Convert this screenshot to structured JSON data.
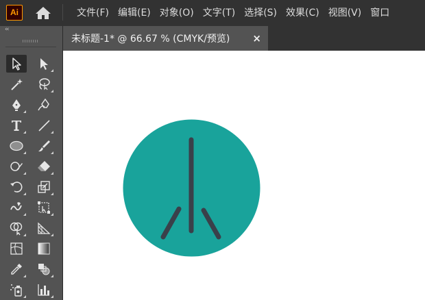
{
  "app": {
    "logo_text": "Ai",
    "accent_color": "#ff9a00"
  },
  "menu": {
    "items": [
      "文件(F)",
      "编辑(E)",
      "对象(O)",
      "文字(T)",
      "选择(S)",
      "效果(C)",
      "视图(V)",
      "窗口"
    ]
  },
  "toolbar": {
    "collapse_label": "‹‹",
    "tools": [
      {
        "icon": "selection-tool-icon",
        "active": true
      },
      {
        "icon": "direct-selection-tool-icon"
      },
      {
        "icon": "magic-wand-tool-icon"
      },
      {
        "icon": "lasso-tool-icon"
      },
      {
        "icon": "pen-tool-icon"
      },
      {
        "icon": "curvature-tool-icon"
      },
      {
        "icon": "type-tool-icon"
      },
      {
        "icon": "line-segment-tool-icon"
      },
      {
        "icon": "ellipse-tool-icon"
      },
      {
        "icon": "paintbrush-tool-icon"
      },
      {
        "icon": "shaper-tool-icon"
      },
      {
        "icon": "eraser-tool-icon"
      },
      {
        "icon": "rotate-tool-icon"
      },
      {
        "icon": "scale-tool-icon"
      },
      {
        "icon": "warp-tool-icon"
      },
      {
        "icon": "free-transform-tool-icon"
      },
      {
        "icon": "shape-builder-tool-icon"
      },
      {
        "icon": "perspective-grid-tool-icon"
      },
      {
        "icon": "mesh-tool-icon"
      },
      {
        "icon": "gradient-tool-icon"
      },
      {
        "icon": "eyedropper-tool-icon"
      },
      {
        "icon": "blend-tool-icon"
      },
      {
        "icon": "symbol-sprayer-tool-icon"
      },
      {
        "icon": "column-graph-tool-icon"
      }
    ]
  },
  "document": {
    "tab_title": "未标题-1* @ 66.67 % (CMYK/预览)",
    "close_label": "×"
  },
  "artwork": {
    "circle_color": "#19a39b",
    "stroke_color": "#3a404a"
  }
}
